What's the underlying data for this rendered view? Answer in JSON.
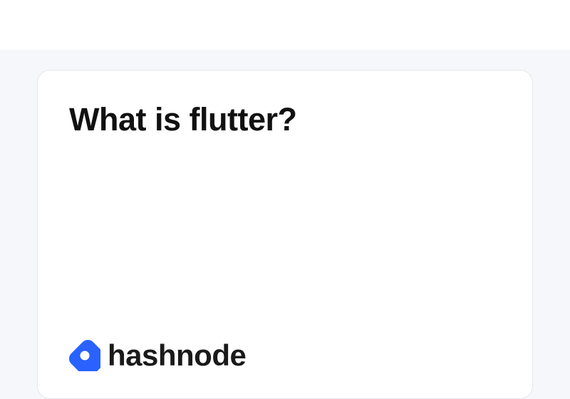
{
  "card": {
    "title": "What is flutter?"
  },
  "brand": {
    "name": "hashnode",
    "icon": "hashnode-logo",
    "color": "#2962FF"
  }
}
